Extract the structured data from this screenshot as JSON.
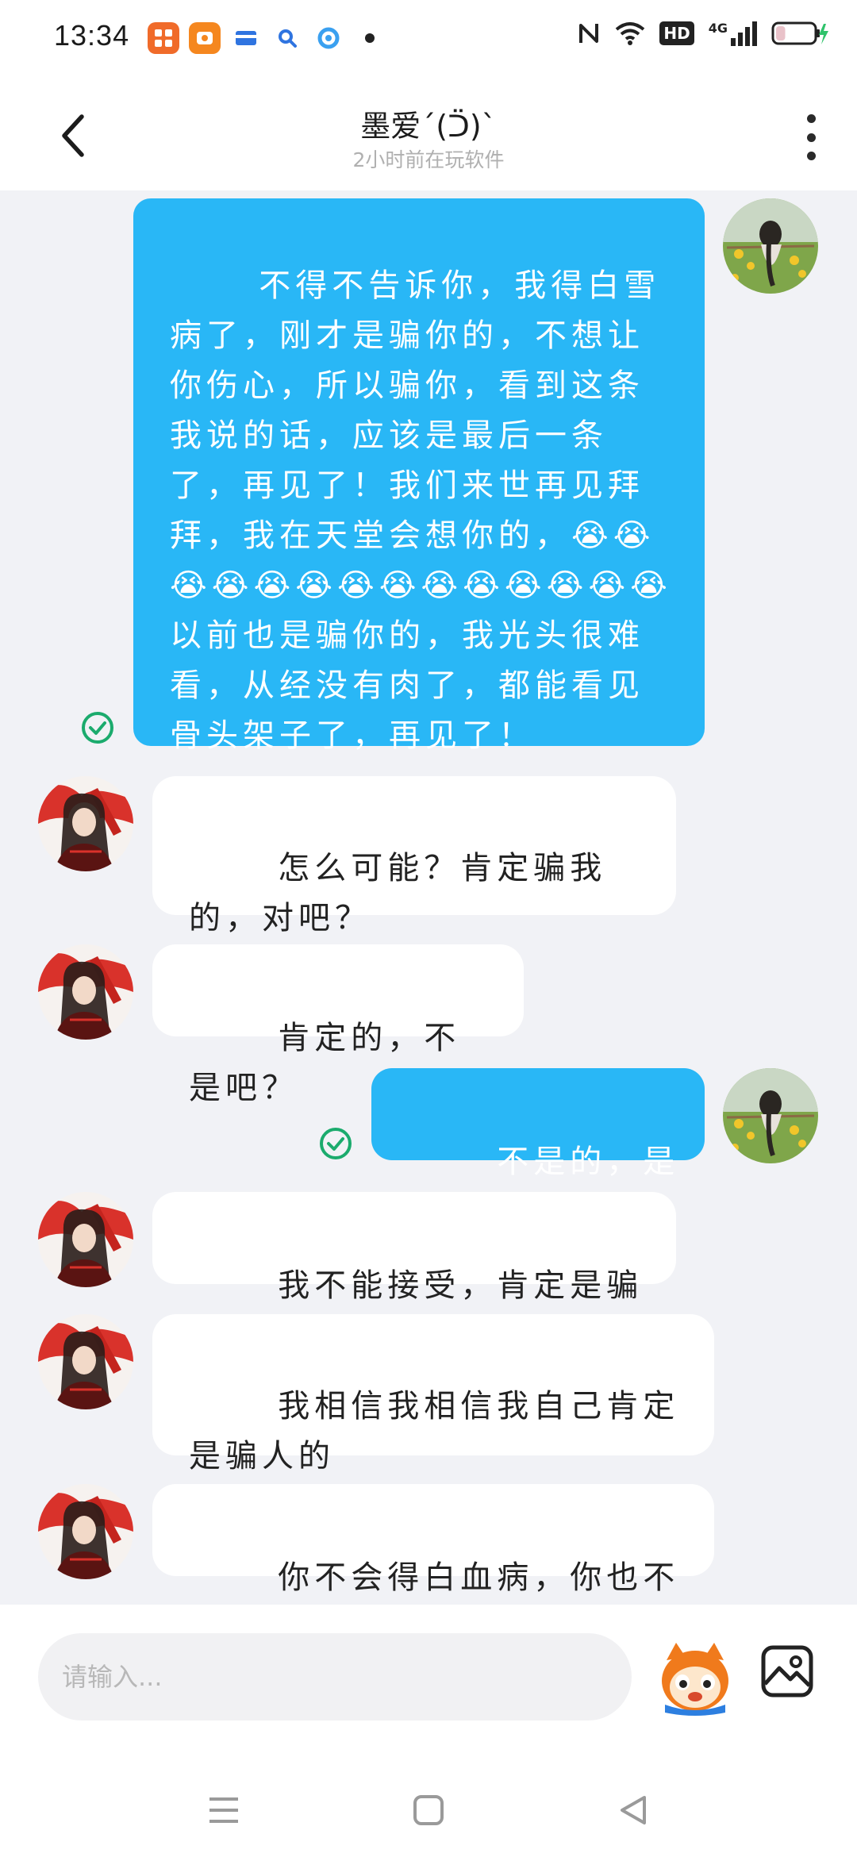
{
  "status_bar": {
    "time": "13:34",
    "app_icons": [
      "app-grid-icon",
      "app-orange-icon",
      "app-card-icon",
      "app-search-icon",
      "app-browser-icon"
    ],
    "indicators": [
      "nfc-icon",
      "wifi-icon",
      "hd-icon",
      "signal-4g-icon",
      "battery-icon"
    ],
    "network_label": "4G",
    "hd_label": "HD",
    "battery_level": 0.25
  },
  "header": {
    "title": "墨爱ˊ(ᑒ)ˋ",
    "status": "2小时前在玩软件",
    "back_icon": "chevron-left-icon",
    "more_icon": "more-vertical-icon"
  },
  "messages": [
    {
      "from": "me",
      "text": "不得不告诉你，我得白雪病了，刚才是骗你的，不想让你伤心，所以骗你，看到这条我说的话，应该是最后一条了，再见了！我们来世再见拜拜，我在天堂会想你的，😭😭😭😭😭😭😭😭😭😭😭😭😭😭以前也是骗你的，我光头很难看，从经没有肉了，都能看见骨头架子了，再见了！",
      "read": true
    },
    {
      "from": "other",
      "text": "怎么可能？肯定骗我的，对吧？"
    },
    {
      "from": "other",
      "text": "肯定的，不是吧？"
    },
    {
      "from": "me",
      "text": "不是的，是真的",
      "read": true
    },
    {
      "from": "other",
      "text": "我不能接受，肯定是骗人的"
    },
    {
      "from": "other",
      "text": "我相信我相信我自己肯定是骗人的"
    },
    {
      "from": "other",
      "text": "你不会得白血病，你也不会死"
    }
  ],
  "input": {
    "placeholder": "请输入..."
  },
  "colors": {
    "outgoing_bubble": "#29b7f6",
    "incoming_bubble": "#ffffff",
    "chat_background": "#f1f2f6",
    "read_check": "#1bab6d"
  }
}
